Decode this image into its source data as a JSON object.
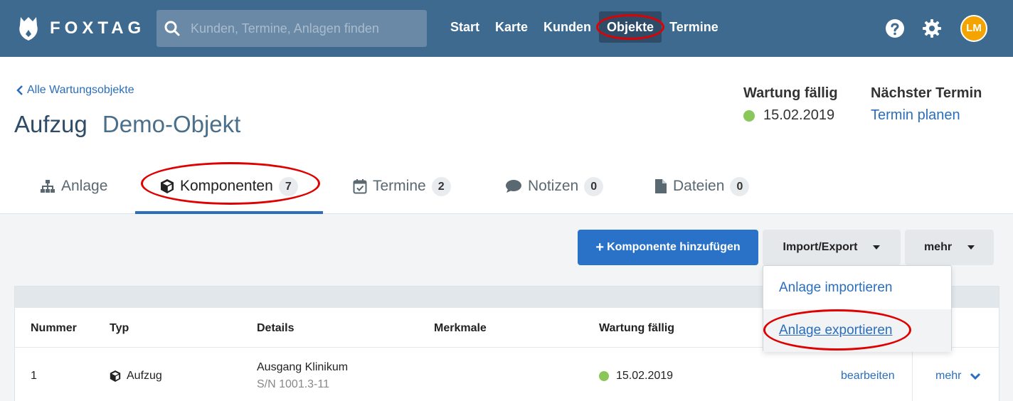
{
  "app": {
    "brand": "FOXTAG",
    "brand_color": "#3d6a8e",
    "accent_color": "#2a72c8",
    "highlight_color": "#e00000"
  },
  "search": {
    "placeholder": "Kunden, Termine, Anlagen finden"
  },
  "nav": {
    "items": [
      {
        "label": "Start",
        "active": false
      },
      {
        "label": "Karte",
        "active": false
      },
      {
        "label": "Kunden",
        "active": false
      },
      {
        "label": "Objekte",
        "active": true
      },
      {
        "label": "Termine",
        "active": false
      }
    ]
  },
  "user": {
    "initials": "LM"
  },
  "header": {
    "back_link": "Alle Wartungsobjekte",
    "type": "Aufzug",
    "name": "Demo-Objekt",
    "due_label": "Wartung fällig",
    "due_date": "15.02.2019",
    "next_label": "Nächster Termin",
    "next_action": "Termin planen"
  },
  "tabs": [
    {
      "label": "Anlage",
      "icon": "sitemap-icon",
      "count": null
    },
    {
      "label": "Komponenten",
      "icon": "cube-icon",
      "count": "7",
      "active": true
    },
    {
      "label": "Termine",
      "icon": "calendar-check-icon",
      "count": "2"
    },
    {
      "label": "Notizen",
      "icon": "comment-icon",
      "count": "0"
    },
    {
      "label": "Dateien",
      "icon": "file-icon",
      "count": "0"
    }
  ],
  "toolbar": {
    "add_label": "Komponente hinzufügen",
    "import_export_label": "Import/Export",
    "more_label": "mehr"
  },
  "dropdown": {
    "items": [
      "Anlage importieren",
      "Anlage exportieren"
    ]
  },
  "table": {
    "columns": [
      "Nummer",
      "Typ",
      "Details",
      "Merkmale",
      "Wartung fällig"
    ],
    "rows": [
      {
        "number": "1",
        "type": "Aufzug",
        "details": "Ausgang Klinikum",
        "serial": "S/N 1001.3-11",
        "features": "",
        "due": "15.02.2019",
        "edit": "bearbeiten",
        "more": "mehr"
      }
    ]
  }
}
